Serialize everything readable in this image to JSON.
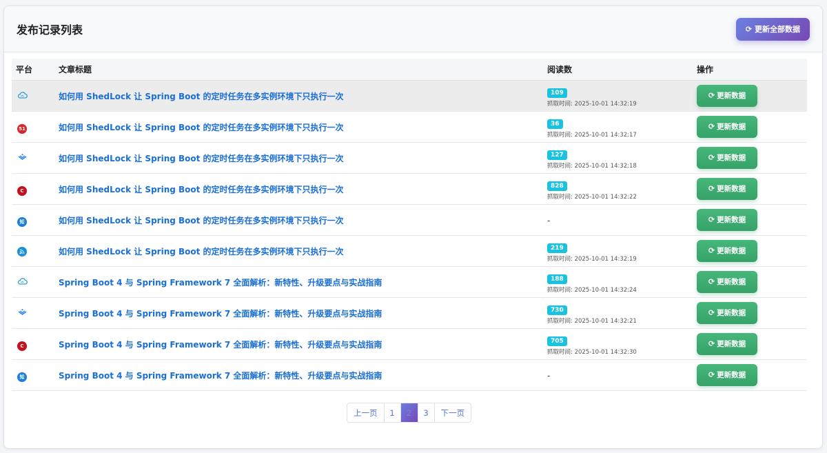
{
  "header": {
    "title": "发布记录列表",
    "refresh_all_label": "更新全部数据"
  },
  "table": {
    "columns": {
      "platform": "平台",
      "title": "文章标题",
      "reads": "阅读数",
      "action": "操作"
    },
    "rows": [
      {
        "platform_icon": "cloud-icon",
        "title": "如何用 ShedLock 让 Spring Boot 的定时任务在多实例环境下只执行一次",
        "reads": "109",
        "fetch_time": "抓取时间: 2025-10-01 14:32:19",
        "action": "更新数据"
      },
      {
        "platform_icon": "51cto-icon",
        "platform_text": "51",
        "title": "如何用 ShedLock 让 Spring Boot 的定时任务在多实例环境下只执行一次",
        "reads": "36",
        "fetch_time": "抓取时间: 2025-10-01 14:32:17",
        "action": "更新数据"
      },
      {
        "platform_icon": "juejin-icon",
        "title": "如何用 ShedLock 让 Spring Boot 的定时任务在多实例环境下只执行一次",
        "reads": "127",
        "fetch_time": "抓取时间: 2025-10-01 14:32:18",
        "action": "更新数据"
      },
      {
        "platform_icon": "csdn-icon",
        "platform_text": "C",
        "title": "如何用 ShedLock 让 Spring Boot 的定时任务在多实例环境下只执行一次",
        "reads": "828",
        "fetch_time": "抓取时间: 2025-10-01 14:32:22",
        "action": "更新数据"
      },
      {
        "platform_icon": "zhihu-icon",
        "platform_text": "知",
        "title": "如何用 ShedLock 让 Spring Boot 的定时任务在多实例环境下只执行一次",
        "reads": "-",
        "fetch_time": "",
        "action": "更新数据"
      },
      {
        "platform_icon": "rss-icon",
        "title": "如何用 ShedLock 让 Spring Boot 的定时任务在多实例环境下只执行一次",
        "reads": "219",
        "fetch_time": "抓取时间: 2025-10-01 14:32:19",
        "action": "更新数据"
      },
      {
        "platform_icon": "cloud-icon",
        "title": "Spring Boot 4 与 Spring Framework 7 全面解析：新特性、升级要点与实战指南",
        "reads": "188",
        "fetch_time": "抓取时间: 2025-10-01 14:32:24",
        "action": "更新数据"
      },
      {
        "platform_icon": "juejin-icon",
        "title": "Spring Boot 4 与 Spring Framework 7 全面解析：新特性、升级要点与实战指南",
        "reads": "730",
        "fetch_time": "抓取时间: 2025-10-01 14:32:21",
        "action": "更新数据"
      },
      {
        "platform_icon": "csdn-icon",
        "platform_text": "C",
        "title": "Spring Boot 4 与 Spring Framework 7 全面解析：新特性、升级要点与实战指南",
        "reads": "705",
        "fetch_time": "抓取时间: 2025-10-01 14:32:30",
        "action": "更新数据"
      },
      {
        "platform_icon": "zhihu-icon",
        "platform_text": "知",
        "title": "Spring Boot 4 与 Spring Framework 7 全面解析：新特性、升级要点与实战指南",
        "reads": "-",
        "fetch_time": "",
        "action": "更新数据"
      }
    ]
  },
  "pagination": {
    "prev": "上一页",
    "pages": [
      "1",
      "2",
      "3"
    ],
    "current": "2",
    "next": "下一页"
  },
  "colors": {
    "link": "#1a6fd6",
    "badge": "#19c2df",
    "action_button": "#3fad72",
    "primary_gradient_start": "#6a80e0",
    "primary_gradient_end": "#7748b4"
  }
}
